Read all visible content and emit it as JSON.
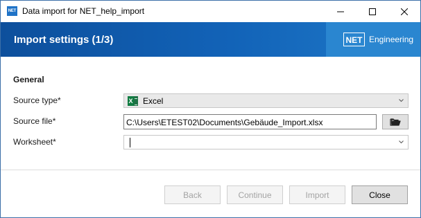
{
  "window": {
    "app_icon_text": "NET",
    "title": "Data import for NET_help_import"
  },
  "banner": {
    "title": "Import settings (1/3)",
    "logo_mark": "NET",
    "logo_text": "Engineering"
  },
  "form": {
    "section_title": "General",
    "source_type": {
      "label": "Source type*",
      "value": "Excel",
      "icon": "excel-icon"
    },
    "source_file": {
      "label": "Source file*",
      "value": "C:\\Users\\ETEST02\\Documents\\Gebäude_Import.xlsx",
      "browse_icon": "folder-icon"
    },
    "worksheet": {
      "label": "Worksheet*",
      "value": ""
    }
  },
  "buttons": {
    "back": "Back",
    "continue": "Continue",
    "import": "Import",
    "close": "Close"
  },
  "colors": {
    "banner_blue": "#1263b8",
    "logo_panel": "#2a86d0",
    "excel_green": "#107c41"
  }
}
